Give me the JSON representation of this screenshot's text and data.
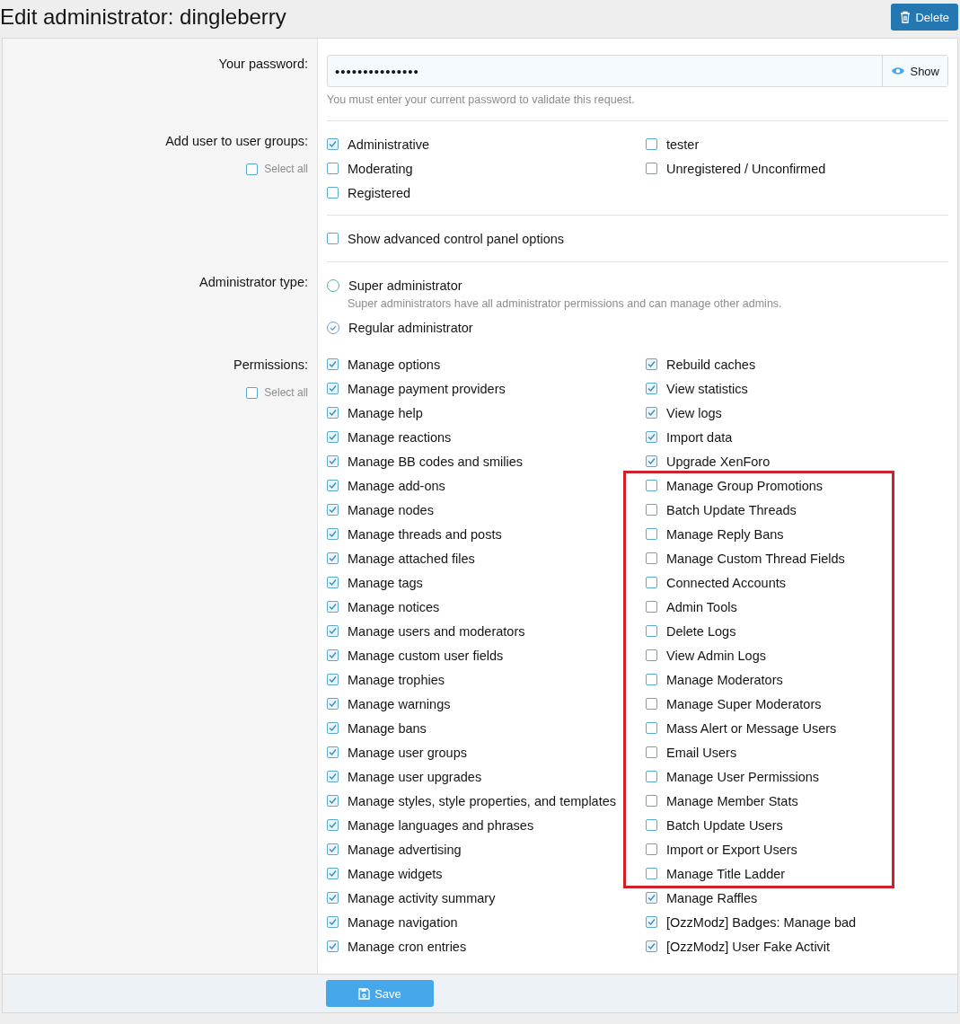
{
  "title": "Edit administrator: dingleberry",
  "delete_button": "Delete",
  "password": {
    "label": "Your password:",
    "value": "•••••••••••••••",
    "show_button": "Show",
    "hint": "You must enter your current password to validate this request."
  },
  "user_groups": {
    "label": "Add user to user groups:",
    "select_all": {
      "label": "Select all",
      "checked": false
    },
    "columns": [
      [
        {
          "label": "Administrative",
          "checked": true
        },
        {
          "label": "Moderating",
          "checked": false
        },
        {
          "label": "Registered",
          "checked": false
        }
      ],
      [
        {
          "label": "tester",
          "checked": false
        },
        {
          "label": "Unregistered / Unconfirmed",
          "checked": false
        }
      ]
    ]
  },
  "advanced": {
    "label": "Show advanced control panel options",
    "checked": false
  },
  "admin_type": {
    "label": "Administrator type:",
    "options": [
      {
        "label": "Super administrator",
        "hint": "Super administrators have all administrator permissions and can manage other admins.",
        "selected": false
      },
      {
        "label": "Regular administrator",
        "selected": true
      }
    ]
  },
  "permissions": {
    "label": "Permissions:",
    "select_all": {
      "label": "Select all",
      "checked": false
    },
    "columns": [
      [
        {
          "highlighted": false,
          "items": [
            {
              "label": "Manage options",
              "checked": true
            },
            {
              "label": "Manage payment providers",
              "checked": true
            },
            {
              "label": "Manage help",
              "checked": true
            },
            {
              "label": "Manage reactions",
              "checked": true
            },
            {
              "label": "Manage BB codes and smilies",
              "checked": true
            },
            {
              "label": "Manage add-ons",
              "checked": true
            },
            {
              "label": "Manage nodes",
              "checked": true
            },
            {
              "label": "Manage threads and posts",
              "checked": true
            },
            {
              "label": "Manage attached files",
              "checked": true
            },
            {
              "label": "Manage tags",
              "checked": true
            },
            {
              "label": "Manage notices",
              "checked": true
            },
            {
              "label": "Manage users and moderators",
              "checked": true
            },
            {
              "label": "Manage custom user fields",
              "checked": true
            },
            {
              "label": "Manage trophies",
              "checked": true
            },
            {
              "label": "Manage warnings",
              "checked": true
            },
            {
              "label": "Manage bans",
              "checked": true
            },
            {
              "label": "Manage user groups",
              "checked": true
            },
            {
              "label": "Manage user upgrades",
              "checked": true
            },
            {
              "label": "Manage styles, style properties, and templates",
              "checked": true
            },
            {
              "label": "Manage languages and phrases",
              "checked": true
            },
            {
              "label": "Manage advertising",
              "checked": true
            },
            {
              "label": "Manage widgets",
              "checked": true
            },
            {
              "label": "Manage activity summary",
              "checked": true
            },
            {
              "label": "Manage navigation",
              "checked": true
            },
            {
              "label": "Manage cron entries",
              "checked": true
            }
          ]
        }
      ],
      [
        {
          "highlighted": false,
          "items": [
            {
              "label": "Rebuild caches",
              "checked": true
            },
            {
              "label": "View statistics",
              "checked": true
            },
            {
              "label": "View logs",
              "checked": true
            },
            {
              "label": "Import data",
              "checked": true
            },
            {
              "label": "Upgrade XenForo",
              "checked": true
            }
          ]
        },
        {
          "highlighted": true,
          "items": [
            {
              "label": "Manage Group Promotions",
              "checked": false
            },
            {
              "label": "Batch Update Threads",
              "checked": false
            },
            {
              "label": "Manage Reply Bans",
              "checked": false
            },
            {
              "label": "Manage Custom Thread Fields",
              "checked": false
            },
            {
              "label": "Connected Accounts",
              "checked": false
            },
            {
              "label": "Admin Tools",
              "checked": false
            },
            {
              "label": "Delete Logs",
              "checked": false
            },
            {
              "label": "View Admin Logs",
              "checked": false
            },
            {
              "label": "Manage Moderators",
              "checked": false
            },
            {
              "label": "Manage Super Moderators",
              "checked": false
            },
            {
              "label": "Mass Alert or Message Users",
              "checked": false
            },
            {
              "label": "Email Users",
              "checked": false
            },
            {
              "label": "Manage User Permissions",
              "checked": false
            },
            {
              "label": "Manage Member Stats",
              "checked": false
            },
            {
              "label": "Batch Update Users",
              "checked": false
            },
            {
              "label": "Import or Export Users",
              "checked": false
            },
            {
              "label": "Manage Title Ladder",
              "checked": false
            }
          ]
        },
        {
          "highlighted": false,
          "items": [
            {
              "label": "Manage Raffles",
              "checked": true
            },
            {
              "label": "[OzzModz] Badges: Manage bad",
              "checked": true
            },
            {
              "label": "[OzzModz] User Fake Activit",
              "checked": true
            }
          ]
        }
      ]
    ]
  },
  "save_button": "Save"
}
